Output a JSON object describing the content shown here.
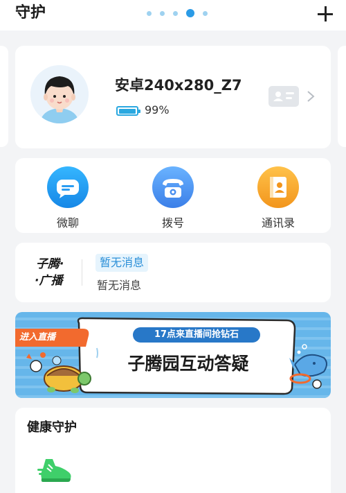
{
  "header": {
    "title": "守护",
    "page_dots": {
      "count": 5,
      "active_index": 3
    },
    "add_icon": "plus-icon"
  },
  "profile": {
    "device_name": "安卓240x280_Z7",
    "battery_percent": 99,
    "battery_text": "99%",
    "battery_icon": "battery-icon",
    "contact_card_icon": "contact-card-icon",
    "chevron_icon": "chevron-right-icon"
  },
  "actions": [
    {
      "label": "微聊",
      "icon": "chat-bubble-icon",
      "color": "#1e9ff2"
    },
    {
      "label": "拨号",
      "icon": "telephone-icon",
      "color": "#4a8ff0"
    },
    {
      "label": "通讯录",
      "icon": "address-book-icon",
      "color": "#f6a623"
    }
  ],
  "broadcast": {
    "logo_line1": "子腾·",
    "logo_line2": "·广播",
    "tag": "暂无消息",
    "subtitle": "暂无消息"
  },
  "banner": {
    "badge": "进入直播",
    "subtitle": "17点来直播间抢钻石",
    "title": "子腾园互动答疑"
  },
  "health": {
    "title": "健康守护",
    "icon": "sneaker-icon"
  },
  "colors": {
    "accent": "#2b9be6",
    "background": "#f3f4f6",
    "banner_blue": "#66b6ea",
    "banner_badge": "#f26a2e"
  }
}
